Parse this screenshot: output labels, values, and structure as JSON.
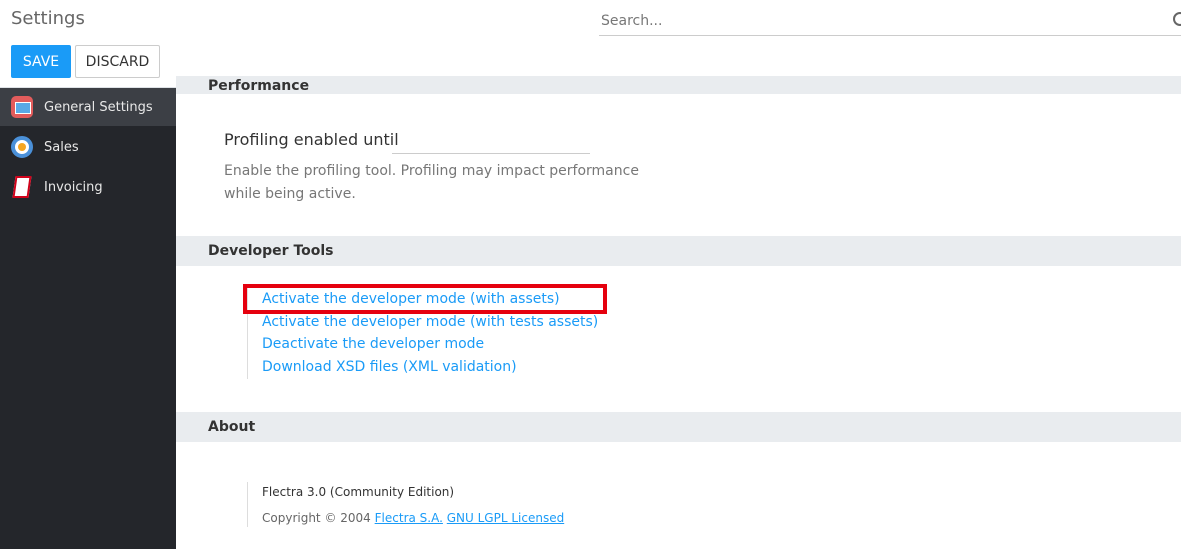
{
  "header": {
    "title": "Settings",
    "search_placeholder": "Search...",
    "save_label": "SAVE",
    "discard_label": "DISCARD"
  },
  "sidebar": {
    "items": [
      {
        "label": "General Settings",
        "icon": "general-settings-icon",
        "active": true
      },
      {
        "label": "Sales",
        "icon": "sales-target-icon",
        "active": false
      },
      {
        "label": "Invoicing",
        "icon": "invoice-icon",
        "active": false
      }
    ]
  },
  "main": {
    "performance": {
      "heading": "Performance",
      "setting_title": "Profiling enabled until",
      "help_text": "Enable the profiling tool. Profiling may impact performance while being active."
    },
    "developer_tools": {
      "heading": "Developer Tools",
      "links": [
        "Activate the developer mode (with assets)",
        "Activate the developer mode (with tests assets)",
        "Deactivate the developer mode",
        "Download XSD files (XML validation)"
      ]
    },
    "about": {
      "heading": "About",
      "version": "Flectra 3.0 (Community Edition)",
      "copyright_prefix": "Copyright © 2004",
      "company_link": "Flectra S.A.",
      "license_link": "GNU LGPL Licensed"
    }
  },
  "colors": {
    "accent": "#1a9bf7",
    "sidebar_bg": "#24262b",
    "highlight": "#e5000e"
  }
}
